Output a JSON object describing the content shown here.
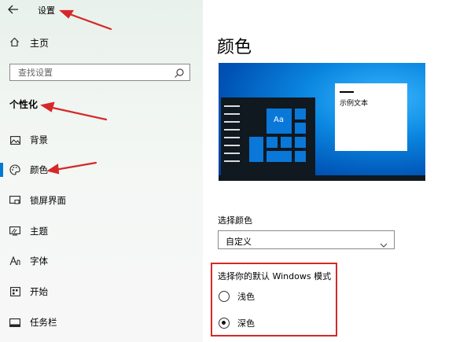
{
  "window": {
    "title": "设置",
    "back_icon": "back-arrow-icon"
  },
  "sidebar": {
    "home_label": "主页",
    "search": {
      "placeholder": "查找设置"
    },
    "section_title": "个性化",
    "items": [
      {
        "label": "背景",
        "icon": "image-icon"
      },
      {
        "label": "颜色",
        "icon": "palette-icon",
        "active": true
      },
      {
        "label": "锁屏界面",
        "icon": "lock-screen-icon"
      },
      {
        "label": "主题",
        "icon": "theme-icon"
      },
      {
        "label": "字体",
        "icon": "font-icon"
      },
      {
        "label": "开始",
        "icon": "start-icon"
      },
      {
        "label": "任务栏",
        "icon": "taskbar-icon"
      }
    ]
  },
  "main": {
    "title": "颜色",
    "preview": {
      "tile_text": "Aa",
      "sample_text": "示例文本"
    },
    "choose_color": {
      "label": "选择颜色",
      "selected": "自定义"
    },
    "mode": {
      "label": "选择你的默认 Windows 模式",
      "options": [
        {
          "label": "浅色",
          "checked": false
        },
        {
          "label": "深色",
          "checked": true
        }
      ]
    }
  },
  "colors": {
    "accent": "#0078d4",
    "annotation": "#d62828"
  }
}
